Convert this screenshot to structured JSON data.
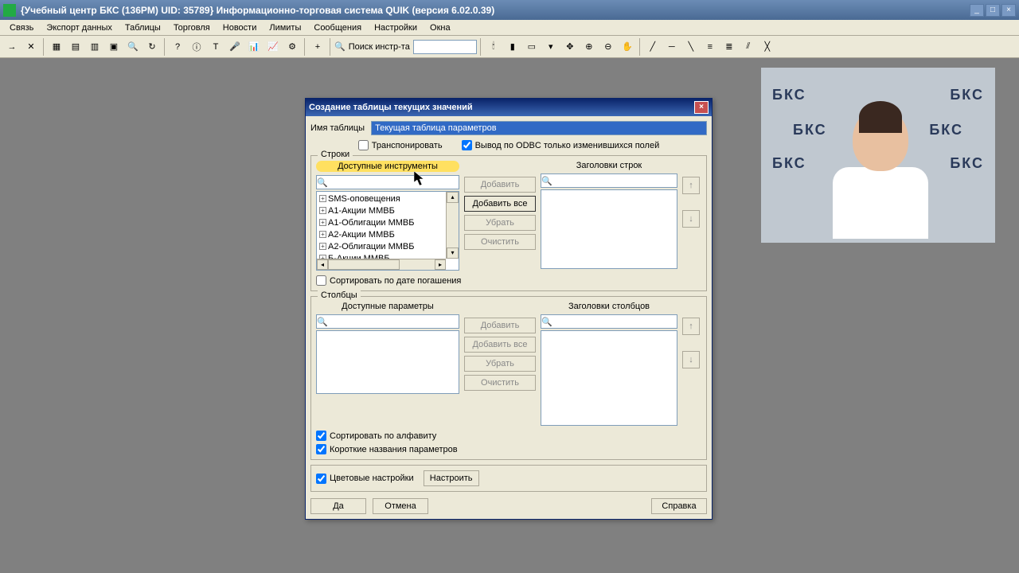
{
  "app": {
    "title": "{Учебный центр БКС (136PM)  UID: 35789} Информационно-торговая система QUIK (версия 6.02.0.39)"
  },
  "menu": {
    "items": [
      "Связь",
      "Экспорт данных",
      "Таблицы",
      "Торговля",
      "Новости",
      "Лимиты",
      "Сообщения",
      "Настройки",
      "Окна"
    ]
  },
  "toolbar": {
    "search_label": "Поиск инстр-та"
  },
  "dialog": {
    "title": "Создание таблицы текущих значений",
    "name_label": "Имя таблицы",
    "name_value": "Текущая таблица параметров",
    "transpose": "Транспонировать",
    "odbc": "Вывод по ODBC только изменившихся полей",
    "rows": {
      "legend": "Строки",
      "available": "Доступные инструменты",
      "headers": "Заголовки строк",
      "items": [
        "SMS-оповещения",
        "А1-Акции ММВБ",
        "А1-Облигации ММВБ",
        "А2-Акции ММВБ",
        "А2-Облигации ММВБ",
        "Б-Акции ММВБ"
      ],
      "sort_by_date": "Сортировать по дате погашения"
    },
    "cols": {
      "legend": "Столбцы",
      "available": "Доступные параметры",
      "headers": "Заголовки столбцов",
      "sort_alpha": "Сортировать по алфавиту",
      "short_names": "Короткие названия параметров"
    },
    "buttons": {
      "add": "Добавить",
      "add_all": "Добавить все",
      "remove": "Убрать",
      "clear": "Очистить"
    },
    "color": {
      "label": "Цветовые настройки",
      "configure": "Настроить"
    },
    "actions": {
      "ok": "Да",
      "cancel": "Отмена",
      "help": "Справка"
    }
  }
}
